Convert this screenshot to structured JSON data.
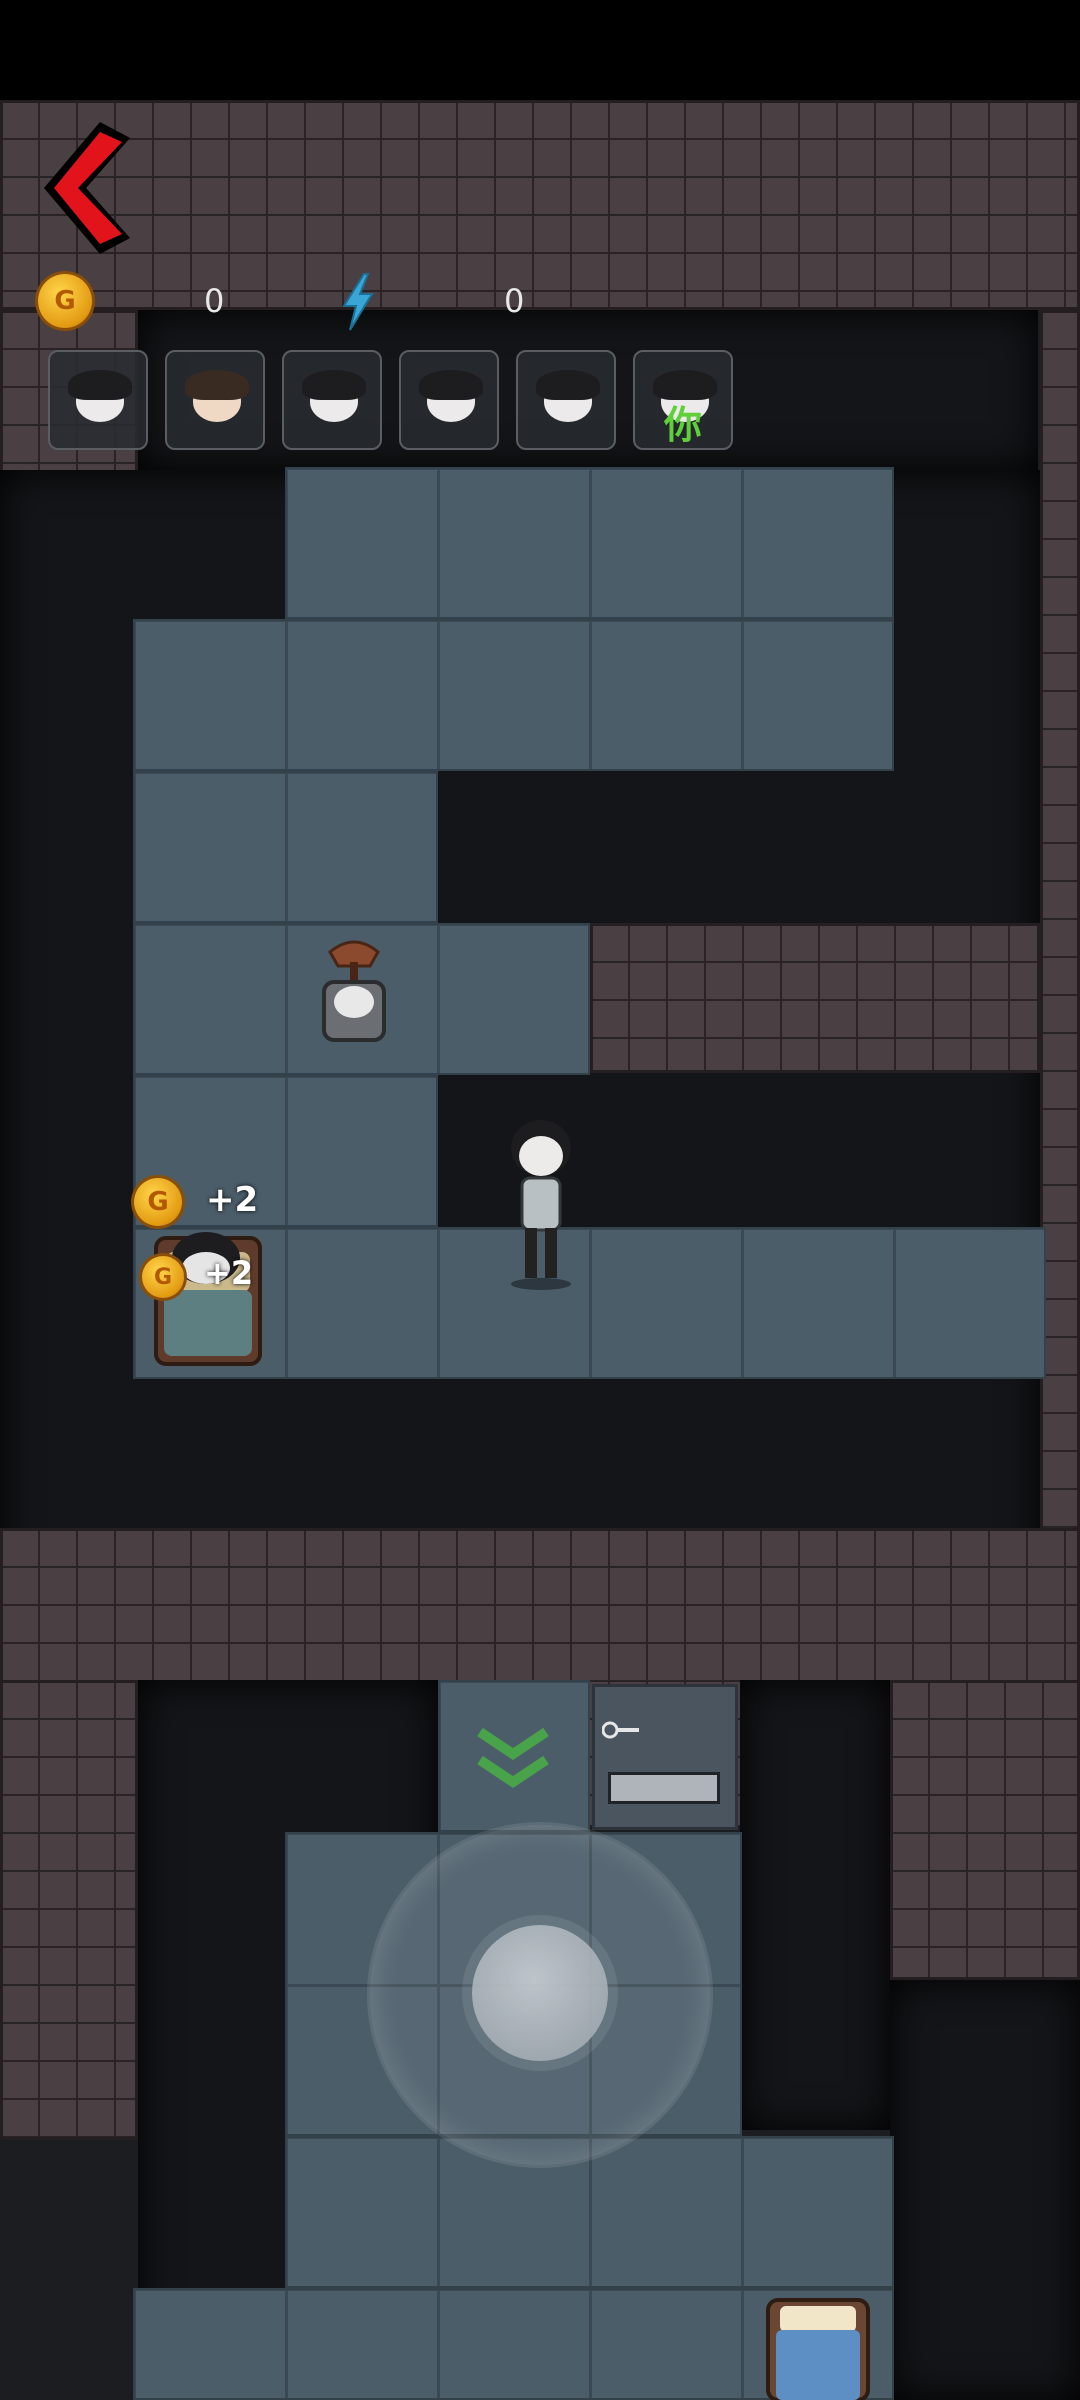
{
  "hud": {
    "coin_icon": "gold-coin-icon",
    "coin_letter": "G",
    "coins": "0",
    "energy_icon": "lightning-bolt-icon",
    "energy": "0",
    "back_icon": "back-chevron-icon",
    "accent": "#e2131b"
  },
  "players": [
    {
      "name": "player-avatar-1"
    },
    {
      "name": "player-avatar-2"
    },
    {
      "name": "player-avatar-3"
    },
    {
      "name": "player-avatar-4"
    },
    {
      "name": "player-avatar-5"
    },
    {
      "name": "player-avatar-6",
      "tag": "你"
    }
  ],
  "pickups": [
    {
      "coin_letter": "G",
      "text": "+2"
    },
    {
      "coin_letter": "G",
      "text": "+2"
    }
  ],
  "controls": {
    "joystick": "virtual-joystick",
    "door_icon": "green-double-chevron-down-icon"
  }
}
